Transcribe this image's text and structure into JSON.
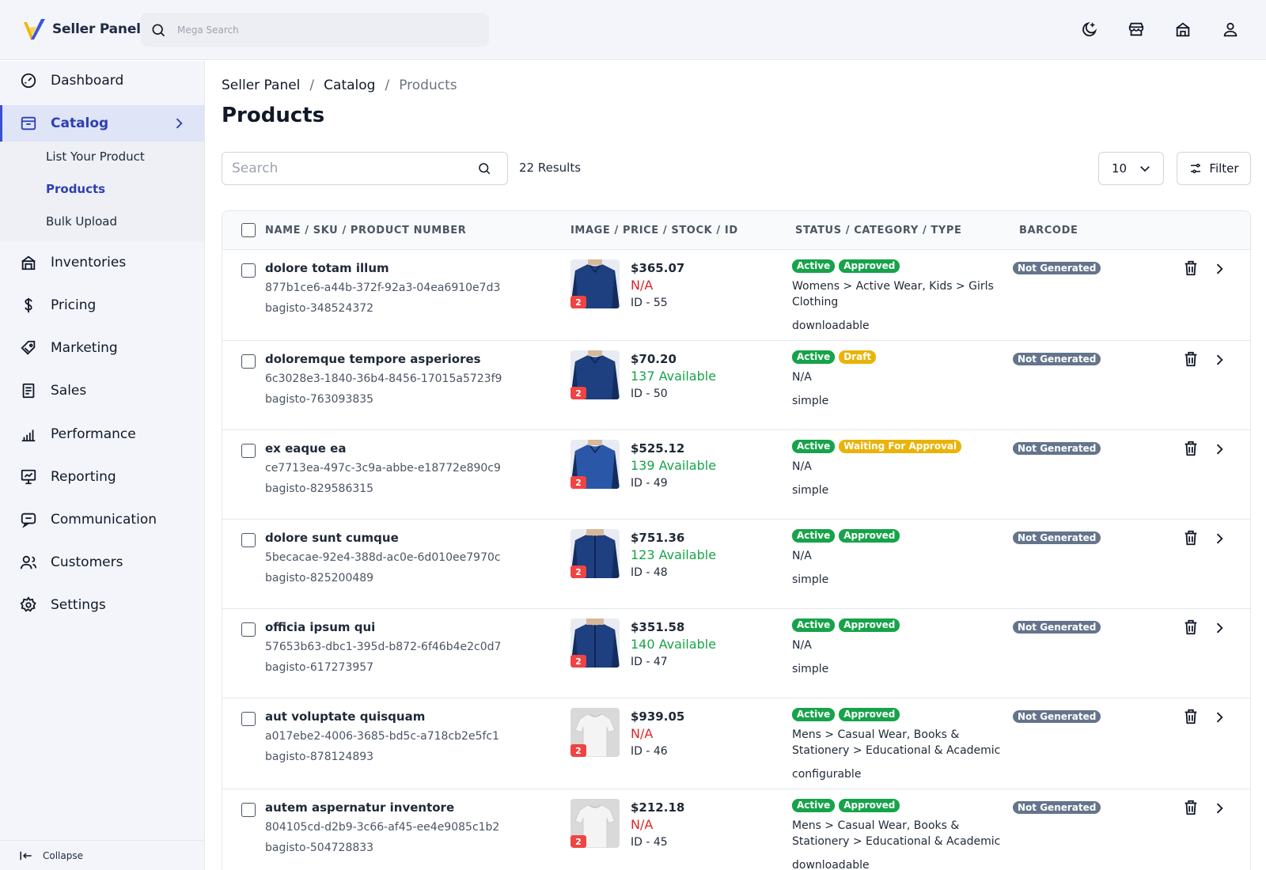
{
  "header": {
    "brand": "Seller Panel",
    "search_placeholder": "Mega Search",
    "icons": [
      "moon-icon",
      "store-icon",
      "building-icon",
      "user-icon"
    ]
  },
  "sidebar": {
    "items": [
      {
        "label": "Dashboard",
        "icon": "dashboard-icon"
      },
      {
        "label": "Catalog",
        "icon": "catalog-icon"
      },
      {
        "label": "Inventories",
        "icon": "inventory-icon"
      },
      {
        "label": "Pricing",
        "icon": "dollar-icon"
      },
      {
        "label": "Marketing",
        "icon": "tag-icon"
      },
      {
        "label": "Sales",
        "icon": "receipt-icon"
      },
      {
        "label": "Performance",
        "icon": "chart-icon"
      },
      {
        "label": "Reporting",
        "icon": "presentation-icon"
      },
      {
        "label": "Communication",
        "icon": "chat-icon"
      },
      {
        "label": "Customers",
        "icon": "users-icon"
      },
      {
        "label": "Settings",
        "icon": "gear-icon"
      }
    ],
    "sub_items": [
      "List Your Product",
      "Products",
      "Bulk Upload"
    ],
    "active_item": "Catalog",
    "active_sub_item": "Products",
    "collapse_label": "Collapse"
  },
  "breadcrumb": [
    "Seller Panel",
    "Catalog",
    "Products"
  ],
  "page_title": "Products",
  "toolbar": {
    "search_placeholder": "Search",
    "results": "22 Results",
    "per_page": "10",
    "filter_label": "Filter"
  },
  "table": {
    "columns": [
      "Name / SKU / Product Number",
      "Image / Price / Stock / ID",
      "Status / Category / Type",
      "Barcode"
    ],
    "rows": [
      {
        "name": "dolore totam illum",
        "sku": "877b1ce6-a44b-372f-92a3-04ea6910e7d3",
        "number": "bagisto-348524372",
        "images": "2",
        "price": "$365.07",
        "stock": "N/A",
        "id": "ID - 55",
        "status": "Active",
        "approval": "Approved",
        "category": "Womens > Active Wear, Kids > Girls Clothing",
        "type": "downloadable",
        "barcode": "Not Generated"
      },
      {
        "name": "doloremque tempore asperiores",
        "sku": "6c3028e3-1840-36b4-8456-17015a5723f9",
        "number": "bagisto-763093835",
        "images": "2",
        "price": "$70.20",
        "stock": "137 Available",
        "id": "ID - 50",
        "status": "Active",
        "approval": "Draft",
        "category": "N/A",
        "type": "simple",
        "barcode": "Not Generated"
      },
      {
        "name": "ex eaque ea",
        "sku": "ce7713ea-497c-3c9a-abbe-e18772e890c9",
        "number": "bagisto-829586315",
        "images": "2",
        "price": "$525.12",
        "stock": "139 Available",
        "id": "ID - 49",
        "status": "Active",
        "approval": "Waiting For Approval",
        "category": "N/A",
        "type": "simple",
        "barcode": "Not Generated"
      },
      {
        "name": "dolore sunt cumque",
        "sku": "5becacae-92e4-388d-ac0e-6d010ee7970c",
        "number": "bagisto-825200489",
        "images": "2",
        "price": "$751.36",
        "stock": "123 Available",
        "id": "ID - 48",
        "status": "Active",
        "approval": "Approved",
        "category": "N/A",
        "type": "simple",
        "barcode": "Not Generated"
      },
      {
        "name": "officia ipsum qui",
        "sku": "57653b63-dbc1-395d-b872-6f46b4e2c0d7",
        "number": "bagisto-617273957",
        "images": "2",
        "price": "$351.58",
        "stock": "140 Available",
        "id": "ID - 47",
        "status": "Active",
        "approval": "Approved",
        "category": "N/A",
        "type": "simple",
        "barcode": "Not Generated"
      },
      {
        "name": "aut voluptate quisquam",
        "sku": "a017ebe2-4006-3685-bd5c-a718cb2e5fc1",
        "number": "bagisto-878124893",
        "images": "2",
        "price": "$939.05",
        "stock": "N/A",
        "id": "ID - 46",
        "status": "Active",
        "approval": "Approved",
        "category": "Mens > Casual Wear, Books & Stationery > Educational & Academic",
        "type": "configurable",
        "barcode": "Not Generated"
      },
      {
        "name": "autem aspernatur inventore",
        "sku": "804105cd-d2b9-3c66-af45-ee4e9085c1b2",
        "number": "bagisto-504728833",
        "images": "2",
        "price": "$212.18",
        "stock": "N/A",
        "id": "ID - 45",
        "status": "Active",
        "approval": "Approved",
        "category": "Mens > Casual Wear, Books & Stationery > Educational & Academic",
        "type": "downloadable",
        "barcode": "Not Generated"
      }
    ]
  },
  "colors": {
    "accent": "#2f3fb0",
    "active_badge": "#16a34a",
    "pending_badge": "#eab308",
    "barcode_badge": "#64748b",
    "stock_na": "#dc2626",
    "stock_available": "#16a34a"
  }
}
